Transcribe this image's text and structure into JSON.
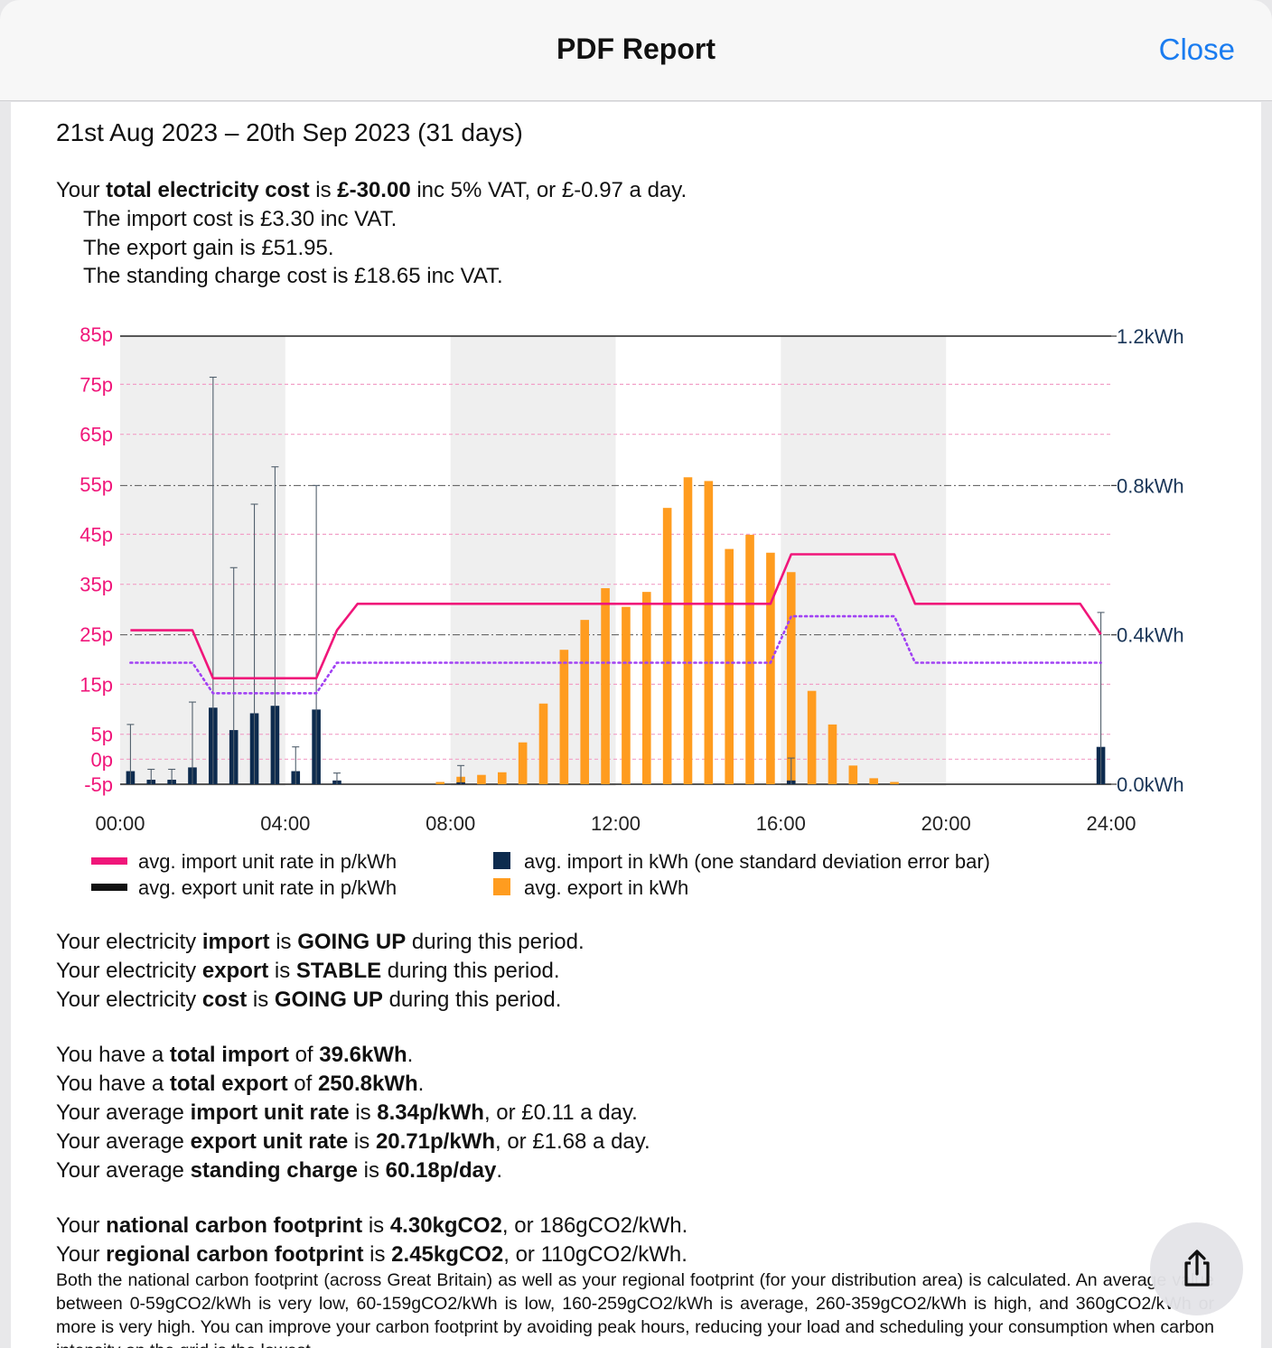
{
  "nav": {
    "title": "PDF Report",
    "close_label": "Close"
  },
  "report": {
    "period": "21st Aug 2023 – 20th Sep 2023 (31 days)",
    "cost": {
      "l1": [
        "Your ",
        "total electricity cost",
        " is ",
        "£-30.00",
        " inc 5% VAT, or £-0.97 a day."
      ],
      "l2": "The import cost is £3.30 inc VAT.",
      "l3": "The export gain is £51.95.",
      "l4": "The standing charge cost is £18.65 inc VAT."
    },
    "trends": [
      [
        "Your electricity ",
        "import",
        " is ",
        "GOING UP",
        " during this period."
      ],
      [
        "Your electricity ",
        "export",
        " is ",
        "STABLE",
        " during this period."
      ],
      [
        "Your electricity ",
        "cost",
        " is ",
        "GOING UP",
        " during this period."
      ]
    ],
    "totals": [
      [
        "You have a ",
        "total import",
        " of ",
        "39.6kWh",
        "."
      ],
      [
        "You have a ",
        "total export",
        " of ",
        "250.8kWh",
        "."
      ],
      [
        "Your average ",
        "import unit rate",
        " is ",
        "8.34p/kWh",
        ", or £0.11 a day."
      ],
      [
        "Your average ",
        "export unit rate",
        " is ",
        "20.71p/kWh",
        ", or £1.68 a day."
      ],
      [
        "Your average ",
        "standing charge",
        " is ",
        "60.18p/day",
        "."
      ]
    ],
    "carbon": [
      [
        "Your ",
        "national carbon footprint",
        " is ",
        "4.30kgCO2",
        ", or 186gCO2/kWh."
      ],
      [
        "Your ",
        "regional carbon footprint",
        " is ",
        "2.45kgCO2",
        ", or 110gCO2/kWh."
      ]
    ],
    "footnote": "Both the national carbon footprint (across Great Britain) as well as your regional footprint (for your distribution area) is calculated. An average value between 0-59gCO2/kWh is very low, 60-159gCO2/kWh is low, 160-259gCO2/kWh is average, 260-359gCO2/kWh is high, and 360gCO2/kWh or more is very high. You can improve your carbon footprint by avoiding peak hours, reducing your load and scheduling your consumption when carbon intensity on the grid is the lowest."
  },
  "colors": {
    "import_rate": "#f0167a",
    "export_rate": "#a142f4",
    "import_kwh": "#0d2b4e",
    "export_kwh": "#ff9c1f",
    "night_band": "#efefef",
    "ios_blue": "#1a7cf0"
  },
  "icons": {
    "share": "share-icon"
  },
  "chart_data": {
    "type": "bar",
    "x_ticks": [
      "00:00",
      "04:00",
      "08:00",
      "12:00",
      "16:00",
      "20:00",
      "24:00"
    ],
    "x_range_hours": [
      0,
      24
    ],
    "y_left": {
      "unit": "p",
      "ticks": [
        "85p",
        "75p",
        "65p",
        "55p",
        "45p",
        "35p",
        "25p",
        "15p",
        "5p",
        "0p",
        "-5p"
      ],
      "range": [
        -5,
        85
      ]
    },
    "y_right": {
      "unit": "kWh",
      "ticks": [
        "1.2kWh",
        "0.8kWh",
        "0.4kWh",
        "0.0kWh"
      ],
      "range": [
        0,
        1.2
      ]
    },
    "shaded_bands_hours": [
      [
        0,
        4
      ],
      [
        8,
        12
      ],
      [
        16,
        20
      ]
    ],
    "legend": [
      {
        "label": "avg. import unit rate in p/kWh",
        "color": "#f0167a"
      },
      {
        "label": "avg. export unit rate in p/kWh",
        "color": "#111111"
      },
      {
        "label": "avg. import in kWh (one standard deviation error bar)",
        "color": "#0d2b4e"
      },
      {
        "label": "avg. export in kWh",
        "color": "#ff9c1f"
      }
    ],
    "series": [
      {
        "name": "avg. import unit rate in p/kWh",
        "kind": "line",
        "points": [
          [
            0.25,
            25.8
          ],
          [
            1.75,
            25.8
          ],
          [
            2.25,
            16.2
          ],
          [
            4.75,
            16.2
          ],
          [
            5.25,
            25.8
          ],
          [
            5.75,
            31.1
          ],
          [
            15.75,
            31.1
          ],
          [
            16.25,
            41.0
          ],
          [
            18.75,
            41.0
          ],
          [
            19.25,
            31.1
          ],
          [
            23.25,
            31.1
          ],
          [
            23.75,
            25.0
          ]
        ]
      },
      {
        "name": "avg. export unit rate in p/kWh",
        "kind": "dotted-line",
        "points": [
          [
            0.25,
            19.3
          ],
          [
            1.75,
            19.3
          ],
          [
            2.25,
            13.2
          ],
          [
            4.75,
            13.2
          ],
          [
            5.25,
            19.3
          ],
          [
            15.75,
            19.3
          ],
          [
            16.25,
            28.6
          ],
          [
            18.75,
            28.6
          ],
          [
            19.25,
            19.3
          ],
          [
            23.75,
            19.3
          ]
        ]
      },
      {
        "name": "avg. import in kWh (one standard deviation error bar)",
        "kind": "bar",
        "points": [
          [
            0.25,
            0.035,
            0.16
          ],
          [
            0.75,
            0.012,
            0.04
          ],
          [
            1.25,
            0.012,
            0.04
          ],
          [
            1.75,
            0.045,
            0.22
          ],
          [
            2.25,
            0.205,
            1.09
          ],
          [
            2.75,
            0.145,
            0.58
          ],
          [
            3.25,
            0.19,
            0.75
          ],
          [
            3.75,
            0.21,
            0.85
          ],
          [
            4.25,
            0.035,
            0.1
          ],
          [
            4.75,
            0.2,
            0.8
          ],
          [
            5.25,
            0.01,
            0.03
          ],
          [
            8.25,
            0.005,
            0.05
          ],
          [
            16.25,
            0.01,
            0.07
          ],
          [
            23.75,
            0.1,
            0.46
          ]
        ]
      },
      {
        "name": "avg. export in kWh",
        "kind": "bar",
        "points": [
          [
            7.75,
            0.006
          ],
          [
            8.25,
            0.02
          ],
          [
            8.75,
            0.025
          ],
          [
            9.25,
            0.032
          ],
          [
            9.75,
            0.112
          ],
          [
            10.25,
            0.216
          ],
          [
            10.75,
            0.36
          ],
          [
            11.25,
            0.44
          ],
          [
            11.75,
            0.525
          ],
          [
            12.25,
            0.475
          ],
          [
            12.75,
            0.515
          ],
          [
            13.25,
            0.74
          ],
          [
            13.75,
            0.822
          ],
          [
            14.25,
            0.812
          ],
          [
            14.75,
            0.63
          ],
          [
            15.25,
            0.668
          ],
          [
            15.75,
            0.62
          ],
          [
            16.25,
            0.568
          ],
          [
            16.75,
            0.25
          ],
          [
            17.25,
            0.16
          ],
          [
            17.75,
            0.05
          ],
          [
            18.25,
            0.016
          ],
          [
            18.75,
            0.006
          ]
        ]
      }
    ]
  }
}
